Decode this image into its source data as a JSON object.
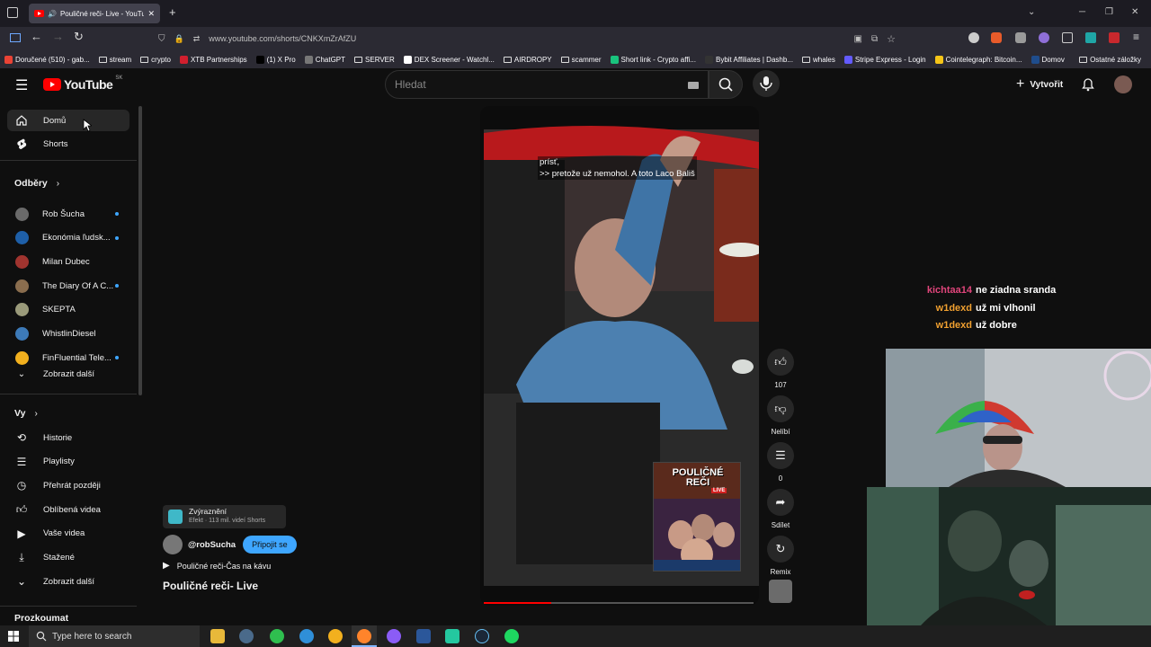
{
  "browser": {
    "tab_title": "Pouličné reči- Live - YouTub",
    "url": "www.youtube.com/shorts/CNKXmZrAfZU",
    "bookmarks": [
      {
        "label": "Doručené (510) - gab...",
        "icon": "gmail-icon",
        "color": "#ea4335"
      },
      {
        "label": "stream",
        "icon": "folder-icon"
      },
      {
        "label": "crypto",
        "icon": "folder-icon"
      },
      {
        "label": "XTB Partnerships",
        "icon": "xtb-icon",
        "color": "#d11f2e"
      },
      {
        "label": "(1) X Pro",
        "icon": "x-icon",
        "color": "#000000"
      },
      {
        "label": "ChatGPT",
        "icon": "chatgpt-icon",
        "color": "#777777"
      },
      {
        "label": "SERVER",
        "icon": "folder-icon"
      },
      {
        "label": "DEX Screener - Watchl...",
        "icon": "dex-icon",
        "color": "#ffffff"
      },
      {
        "label": "AIRDROPY",
        "icon": "folder-icon"
      },
      {
        "label": "scammer",
        "icon": "folder-icon"
      },
      {
        "label": "Short link - Crypto affi...",
        "icon": "link-icon",
        "color": "#19c37d"
      },
      {
        "label": "Bybit Affiliates | Dashb...",
        "icon": "bybit-icon",
        "color": "#333333"
      },
      {
        "label": "whales",
        "icon": "folder-icon"
      },
      {
        "label": "Stripe Express - Login",
        "icon": "stripe-icon",
        "color": "#635bff"
      },
      {
        "label": "Cointelegraph: Bitcoin...",
        "icon": "cointelegraph-icon",
        "color": "#f5c518"
      },
      {
        "label": "Domov",
        "icon": "domov-icon",
        "color": "#1f4d8c"
      }
    ],
    "other_bookmarks": "Ostatné záložky"
  },
  "youtube": {
    "logo_text": "YouTube",
    "region": "SK",
    "search_placeholder": "Hledat",
    "create_label": "Vytvořit"
  },
  "sidebar": {
    "home": "Domů",
    "shorts": "Shorts",
    "subscriptions_header": "Odběry",
    "channels": [
      {
        "name": "Rob Šucha",
        "color": "#6a6a6a",
        "dot": true
      },
      {
        "name": "Ekonómia ľudsk...",
        "color": "#1e5fa8",
        "dot": true
      },
      {
        "name": "Milan Dubec",
        "color": "#a0342f",
        "dot": false
      },
      {
        "name": "The Diary Of A C...",
        "color": "#8a6d4e",
        "dot": true
      },
      {
        "name": "SKEPTA",
        "color": "#9a9a7a",
        "dot": false
      },
      {
        "name": "WhistlinDiesel",
        "color": "#3d7ab8",
        "dot": false
      },
      {
        "name": "FinFluential Tele...",
        "color": "#f2b01e",
        "dot": true
      }
    ],
    "show_more_1": "Zobrazit další",
    "you_header": "Vy",
    "you_items": [
      {
        "label": "Historie",
        "icon": "history-icon"
      },
      {
        "label": "Playlisty",
        "icon": "playlist-icon"
      },
      {
        "label": "Přehrát později",
        "icon": "watch-later-icon"
      },
      {
        "label": "Oblíbená videa",
        "icon": "like-icon"
      },
      {
        "label": "Vaše videa",
        "icon": "your-videos-icon"
      },
      {
        "label": "Stažené",
        "icon": "download-icon"
      },
      {
        "label": "Zobrazit další",
        "icon": "chevron-down-icon"
      }
    ],
    "explore_header": "Prozkoumat"
  },
  "short": {
    "subtitle_line1": "prísť,",
    "subtitle_line2": ">> pretože už nemohol. A toto Laco Bališ",
    "effect_label": "Zvýraznění",
    "effect_sub": "Efekt · 113 mil. videí Shorts",
    "channel": "@robSucha",
    "join_label": "Připojit se",
    "playlist": "Pouličné reči-Čas na kávu",
    "title": "Pouličné reči- Live",
    "thumb_title": "POULIČNÉ REČI",
    "thumb_tag": "LIVE",
    "progress": 0.25
  },
  "actions": {
    "likes": "107",
    "dislike": "Nelíbí",
    "comments": "0",
    "share": "Sdílet",
    "remix": "Remix"
  },
  "chat": [
    {
      "user": "kichtaa14",
      "msg": "ne ziadna sranda",
      "color": "#e0457b"
    },
    {
      "user": "w1dexd",
      "msg": "už mi vlhonil",
      "color": "#f0a030"
    },
    {
      "user": "w1dexd",
      "msg": "už dobre",
      "color": "#f0a030"
    }
  ],
  "taskbar": {
    "search_placeholder": "Type here to search"
  }
}
